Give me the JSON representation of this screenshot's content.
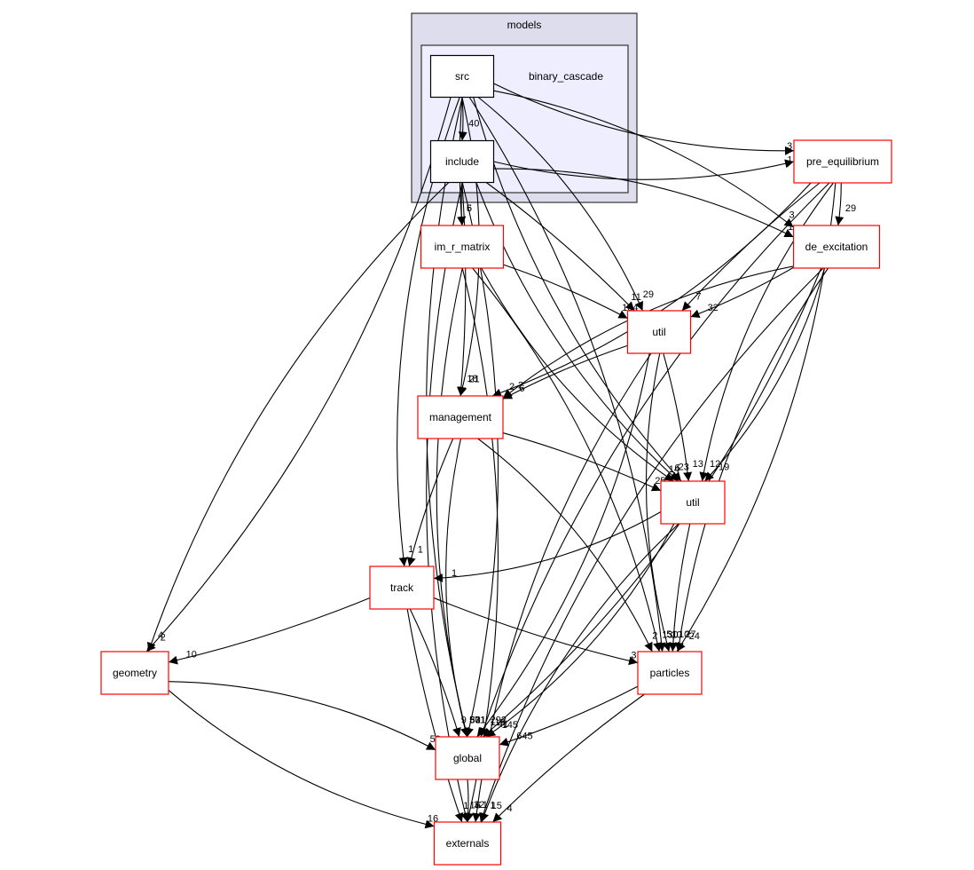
{
  "clusters": {
    "models": {
      "label": "models",
      "fill": "#dddded",
      "stroke": "#404040"
    },
    "binary_cascade": {
      "label": "binary_cascade",
      "fill": "#eeeeff",
      "stroke": "#404040"
    }
  },
  "colors": {
    "node_border_internal": "#000000",
    "node_border_external": "#ff0000",
    "edge": "#000000"
  },
  "nodes": [
    {
      "id": "src",
      "label": "src",
      "internal": true
    },
    {
      "id": "include",
      "label": "include",
      "internal": true
    },
    {
      "id": "pre_equilibrium",
      "label": "pre_equilibrium"
    },
    {
      "id": "de_excitation",
      "label": "de_excitation"
    },
    {
      "id": "im_r_matrix",
      "label": "im_r_matrix"
    },
    {
      "id": "util1",
      "label": "util"
    },
    {
      "id": "management",
      "label": "management"
    },
    {
      "id": "util2",
      "label": "util"
    },
    {
      "id": "track",
      "label": "track"
    },
    {
      "id": "geometry",
      "label": "geometry"
    },
    {
      "id": "particles",
      "label": "particles"
    },
    {
      "id": "global",
      "label": "global"
    },
    {
      "id": "externals",
      "label": "externals"
    }
  ],
  "edges": [
    {
      "from": "src",
      "to": "include",
      "label": "40"
    },
    {
      "from": "src",
      "to": "pre_equilibrium",
      "label": "3"
    },
    {
      "from": "src",
      "to": "de_excitation",
      "label": "3"
    },
    {
      "from": "src",
      "to": "im_r_matrix",
      "label": "5"
    },
    {
      "from": "src",
      "to": "util1",
      "label": "29"
    },
    {
      "from": "src",
      "to": "util2",
      "label": "23"
    },
    {
      "from": "src",
      "to": "management",
      "label": "21"
    },
    {
      "from": "src",
      "to": "track",
      "label": "1"
    },
    {
      "from": "src",
      "to": "geometry",
      "label": "2"
    },
    {
      "from": "src",
      "to": "global",
      "label": "60"
    },
    {
      "from": "src",
      "to": "particles",
      "label": "51"
    },
    {
      "from": "include",
      "to": "pre_equilibrium",
      "label": "1"
    },
    {
      "from": "include",
      "to": "de_excitation",
      "label": "1"
    },
    {
      "from": "include",
      "to": "im_r_matrix",
      "label": "6"
    },
    {
      "from": "include",
      "to": "util1",
      "label": "11"
    },
    {
      "from": "include",
      "to": "util2",
      "label": "6"
    },
    {
      "from": "include",
      "to": "management",
      "label": "18"
    },
    {
      "from": "include",
      "to": "geometry",
      "label": "4"
    },
    {
      "from": "include",
      "to": "global",
      "label": "11"
    },
    {
      "from": "include",
      "to": "externals",
      "label": "16"
    },
    {
      "from": "pre_equilibrium",
      "to": "de_excitation",
      "label": "29"
    },
    {
      "from": "pre_equilibrium",
      "to": "util1",
      "label": "7"
    },
    {
      "from": "pre_equilibrium",
      "to": "management",
      "label": "2"
    },
    {
      "from": "pre_equilibrium",
      "to": "util2",
      "label": "12"
    },
    {
      "from": "pre_equilibrium",
      "to": "particles",
      "label": "24"
    },
    {
      "from": "pre_equilibrium",
      "to": "global",
      "label": "292"
    },
    {
      "from": "de_excitation",
      "to": "util1",
      "label": "32"
    },
    {
      "from": "de_excitation",
      "to": "management",
      "label": "2"
    },
    {
      "from": "de_excitation",
      "to": "util2",
      "label": "19"
    },
    {
      "from": "de_excitation",
      "to": "particles",
      "label": "27"
    },
    {
      "from": "de_excitation",
      "to": "global",
      "label": "41"
    },
    {
      "from": "de_excitation",
      "to": "externals",
      "label": "1"
    },
    {
      "from": "im_r_matrix",
      "to": "util1",
      "label": "104"
    },
    {
      "from": "im_r_matrix",
      "to": "util2",
      "label": "14"
    },
    {
      "from": "im_r_matrix",
      "to": "particles",
      "label": "130"
    },
    {
      "from": "im_r_matrix",
      "to": "global",
      "label": "331"
    },
    {
      "from": "im_r_matrix",
      "to": "externals",
      "label": "6"
    },
    {
      "from": "util1",
      "to": "management",
      "label": "6"
    },
    {
      "from": "util1",
      "to": "util2",
      "label": "13"
    },
    {
      "from": "util1",
      "to": "particles",
      "label": "10"
    },
    {
      "from": "util1",
      "to": "global",
      "label": "118"
    },
    {
      "from": "util1",
      "to": "externals",
      "label": "1"
    },
    {
      "from": "management",
      "to": "util2",
      "label": "25"
    },
    {
      "from": "management",
      "to": "track",
      "label": "1"
    },
    {
      "from": "management",
      "to": "particles",
      "label": "2"
    },
    {
      "from": "management",
      "to": "global",
      "label": "57"
    },
    {
      "from": "util2",
      "to": "track",
      "label": "1"
    },
    {
      "from": "util2",
      "to": "particles",
      "label": "10"
    },
    {
      "from": "util2",
      "to": "global",
      "label": "145"
    },
    {
      "from": "util2",
      "to": "externals",
      "label": "15"
    },
    {
      "from": "track",
      "to": "geometry",
      "label": "10"
    },
    {
      "from": "track",
      "to": "particles",
      "label": "3"
    },
    {
      "from": "track",
      "to": "global",
      "label": "9"
    },
    {
      "from": "track",
      "to": "externals",
      "label": "1"
    },
    {
      "from": "geometry",
      "to": "global",
      "label": "50"
    },
    {
      "from": "geometry",
      "to": "externals",
      "label": "16"
    },
    {
      "from": "particles",
      "to": "global",
      "label": "645"
    },
    {
      "from": "particles",
      "to": "externals",
      "label": "4"
    },
    {
      "from": "global",
      "to": "externals",
      "label": "32"
    }
  ]
}
